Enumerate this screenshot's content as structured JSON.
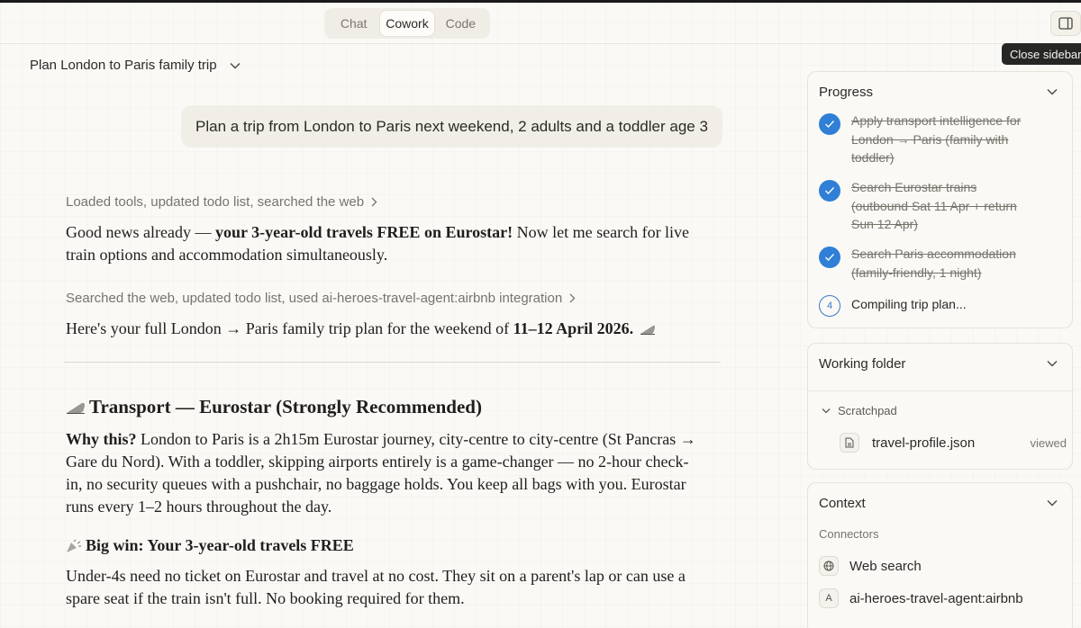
{
  "modes": [
    "Chat",
    "Cowork",
    "Code"
  ],
  "active_mode": "Cowork",
  "tooltip": "Close sidebar",
  "chat_title": "Plan London to Paris family trip",
  "user_message": "Plan a trip from London to Paris next weekend, 2 adults and a toddler age 3",
  "meta1": "Loaded tools, updated todo list, searched the web",
  "para1_bold": "your 3-year-old travels FREE on Eurostar!",
  "para1_pre": "Good news already — ",
  "para1_post": " Now let me search for live train options and accommodation simultaneously.",
  "meta2": "Searched the web, updated todo list, used ai-heroes-travel-agent:airbnb integration",
  "para2_pre": "Here's your full London → Paris family trip plan for the weekend of ",
  "para2_bold": "11–12 April 2026.",
  "heading": "Transport — Eurostar (Strongly Recommended)",
  "why_bold": "Why this?",
  "why_text": " London to Paris is a 2h15m Eurostar journey, city-centre to city-centre (St Pancras → Gare du Nord). With a toddler, skipping airports entirely is a game-changer — no 2-hour check-in, no security queues with a pushchair, no baggage holds. You keep all bags with you. Eurostar runs every 1–2 hours throughout the day.",
  "subheading": "Big win: Your 3-year-old travels FREE",
  "win_text": "Under-4s need no ticket on Eurostar and travel at no cost. They sit on a parent's lap or can use a spare seat if the train isn't full. No booking required for them.",
  "progress": {
    "title": "Progress",
    "steps": [
      {
        "text": "Apply transport intelligence for London → Paris (family with toddler)",
        "done": true
      },
      {
        "text": "Search Eurostar trains (outbound Sat 11 Apr + return Sun 12 Apr)",
        "done": true
      },
      {
        "text": "Search Paris accommodation (family-friendly, 1 night)",
        "done": true
      },
      {
        "text": "Compiling trip plan...",
        "done": false,
        "number": "4"
      }
    ]
  },
  "working_folder": {
    "title": "Working folder",
    "folder": "Scratchpad",
    "file": "travel-profile.json",
    "file_status": "viewed"
  },
  "context": {
    "title": "Context",
    "section": "Connectors",
    "connectors": [
      {
        "label": "Web search",
        "icon": "globe-icon"
      },
      {
        "label": "ai-heroes-travel-agent:airbnb",
        "icon": "letter-a-icon",
        "glyph": "A"
      }
    ]
  }
}
